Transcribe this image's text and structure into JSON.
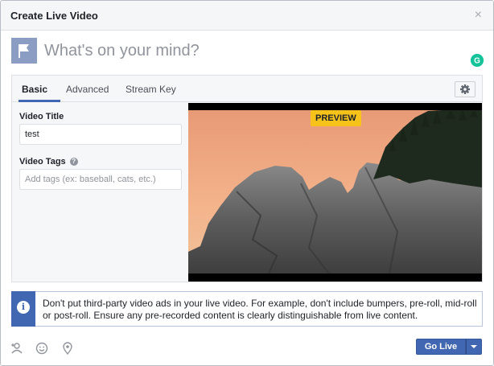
{
  "dialog": {
    "title": "Create Live Video",
    "close_glyph": "×"
  },
  "composer": {
    "placeholder": "What's on your mind?",
    "avatar_icon": "flag-icon",
    "extension_icon": "grammarly-icon",
    "extension_letter": "G"
  },
  "tabs": [
    {
      "label": "Basic",
      "active": true
    },
    {
      "label": "Advanced",
      "active": false
    },
    {
      "label": "Stream Key",
      "active": false
    }
  ],
  "settings_icon": "gear-icon",
  "form": {
    "video_title_label": "Video Title",
    "video_title_value": "test",
    "video_tags_label": "Video Tags",
    "video_tags_info_glyph": "?",
    "video_tags_placeholder": "Add tags (ex: baseball, cats, etc.)"
  },
  "video": {
    "badge": "PREVIEW"
  },
  "notice": {
    "icon_glyph": "i",
    "text": "Don't put third-party video ads in your live video. For example, don't include bumpers, pre-roll, mid-roll or post-roll. Ensure any pre-recorded content is clearly distinguishable from live content."
  },
  "footer": {
    "icons": [
      "tag-people-icon",
      "feeling-icon",
      "location-icon"
    ],
    "go_live_label": "Go Live"
  },
  "colors": {
    "accent": "#4267b2",
    "badge": "#f7c31b"
  }
}
